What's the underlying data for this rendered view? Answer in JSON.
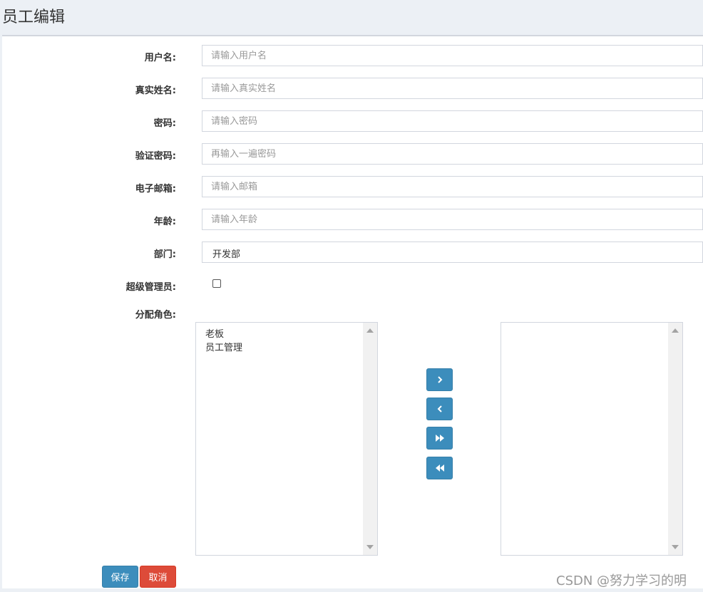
{
  "header": {
    "title": "员工编辑"
  },
  "form": {
    "username": {
      "label": "用户名:",
      "placeholder": "请输入用户名"
    },
    "realname": {
      "label": "真实姓名:",
      "placeholder": "请输入真实姓名"
    },
    "password": {
      "label": "密码:",
      "placeholder": "请输入密码"
    },
    "confirm_password": {
      "label": "验证密码:",
      "placeholder": "再输入一遍密码"
    },
    "email": {
      "label": "电子邮箱:",
      "placeholder": "请输入邮箱"
    },
    "age": {
      "label": "年龄:",
      "placeholder": "请输入年龄"
    },
    "department": {
      "label": "部门:",
      "value": "开发部"
    },
    "super_admin": {
      "label": "超级管理员:",
      "checked": false
    },
    "roles": {
      "label": "分配角色:",
      "available": [
        "老板",
        "员工管理"
      ],
      "selected": []
    }
  },
  "role_buttons": {
    "move_right": "chevron-right-icon",
    "move_left": "chevron-left-icon",
    "move_all_right": "double-forward-icon",
    "move_all_left": "double-backward-icon"
  },
  "actions": {
    "save": "保存",
    "cancel": "取消"
  },
  "watermark": "CSDN @努力学习的明",
  "colors": {
    "primary": "#3c8dbc",
    "danger": "#dd4b39",
    "background": "#ecf0f5"
  }
}
